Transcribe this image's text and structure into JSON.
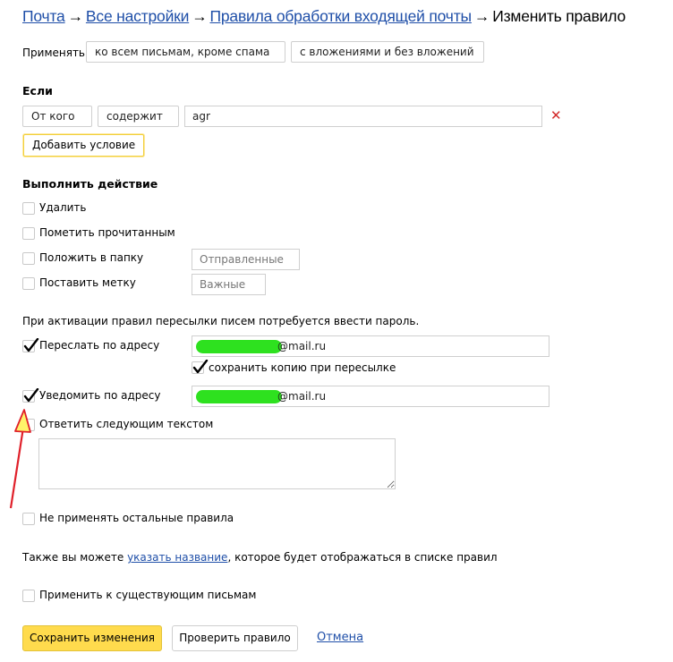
{
  "breadcrumbs": {
    "items": [
      "Почта",
      "Все настройки",
      "Правила обработки входящей почты"
    ],
    "current": "Изменить правило",
    "separator": "→"
  },
  "apply": {
    "label": "Применять",
    "scope": "ко всем письмам, кроме спама",
    "attachments": "с вложениями и без вложений"
  },
  "condition": {
    "heading": "Если",
    "field": "От кого",
    "operator": "содержит",
    "value": "agr",
    "remove_icon": "✕",
    "add_button": "Добавить условие"
  },
  "actions": {
    "heading": "Выполнить действие",
    "delete": {
      "label": "Удалить",
      "checked": false
    },
    "mark_read": {
      "label": "Пометить прочитанным",
      "checked": false
    },
    "move_to_folder": {
      "label": "Положить в папку",
      "checked": false,
      "value": "Отправленные"
    },
    "set_label": {
      "label": "Поставить метку",
      "checked": false,
      "value": "Важные"
    },
    "password_notice": "При активации правил пересылки писем потребуется ввести пароль.",
    "forward": {
      "label": "Переслать по адресу",
      "checked": true,
      "email_suffix": "@mail.ru"
    },
    "keep_copy": {
      "label": "сохранить копию при пересылке",
      "checked": true
    },
    "notify": {
      "label": "Уведомить по адресу",
      "checked": true,
      "email_suffix": "@mail.ru"
    },
    "reply": {
      "label": "Ответить следующим текстом",
      "checked": false,
      "text": ""
    },
    "stop_rules": {
      "label": "Не применять остальные правила",
      "checked": false
    }
  },
  "name_hint": {
    "before": "Также вы можете ",
    "link": "указать название",
    "after": ", которое будет отображаться в списке правил"
  },
  "apply_existing": {
    "label": "Применить к существующим письмам",
    "checked": false
  },
  "footer": {
    "save": "Сохранить изменения",
    "check": "Проверить правило",
    "cancel": "Отмена"
  },
  "colors": {
    "link": "#1f4fa8",
    "save_button": "#ffdb4d",
    "remove_icon": "#d22b2b",
    "redaction": "#2ee11f",
    "annotation_arrow": "#e0202a"
  }
}
